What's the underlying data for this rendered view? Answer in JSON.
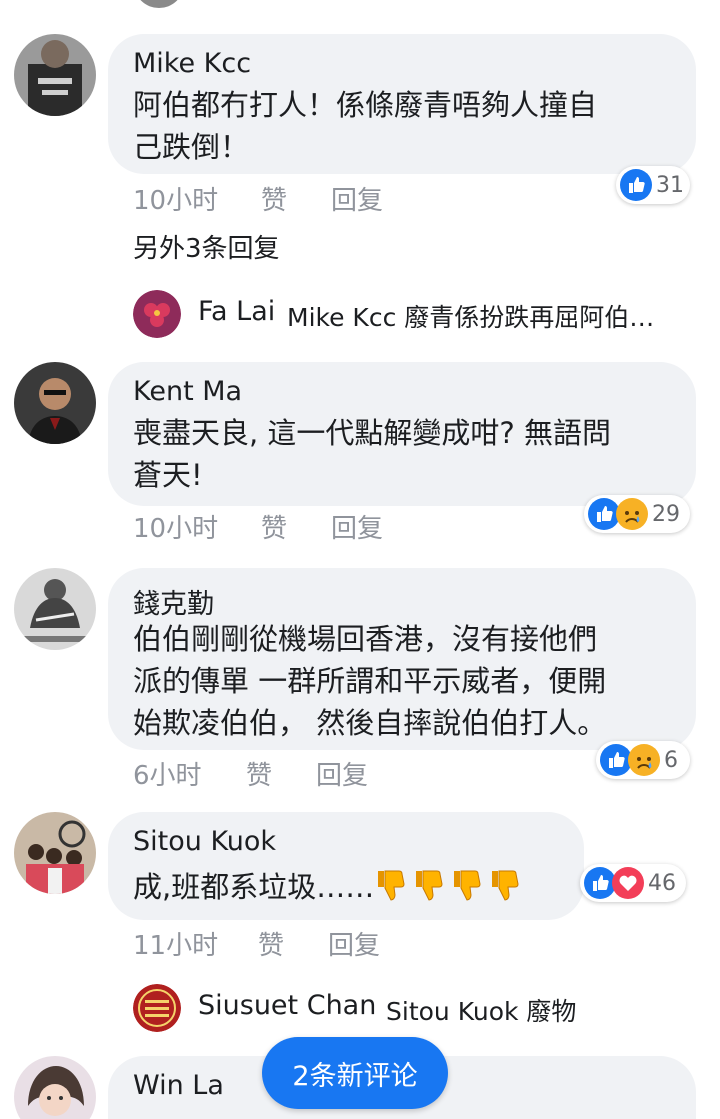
{
  "comments": [
    {
      "author": "Mike Kcc",
      "lines": [
        "阿伯都冇打人！係條廢青唔夠人撞自",
        "己跌倒！"
      ],
      "time": "10小时",
      "like_label": "赞",
      "reply_label": "回复",
      "reaction_count": "31",
      "reactions": [
        "like"
      ]
    },
    {
      "author": "Kent Ma",
      "lines": [
        "喪盡天良, 這一代點解變成咁? 無語問",
        "蒼天!"
      ],
      "time": "10小时",
      "like_label": "赞",
      "reply_label": "回复",
      "reaction_count": "29",
      "reactions": [
        "like",
        "sad"
      ]
    },
    {
      "author": "錢克勤",
      "lines": [
        "伯伯剛剛從機場回香港，沒有接他們",
        "派的傳單 一群所謂和平示威者，便開",
        "始欺凌伯伯， 然後自摔說伯伯打人。"
      ],
      "time": "6小时",
      "like_label": "赞",
      "reply_label": "回复",
      "reaction_count": "6",
      "reactions": [
        "like",
        "sad"
      ]
    },
    {
      "author": "Sitou Kuok",
      "text": "成,班都系垃圾……",
      "time": "11小时",
      "like_label": "赞",
      "reply_label": "回复",
      "reaction_count": "46",
      "reactions": [
        "like",
        "love"
      ]
    },
    {
      "author": "Win La"
    }
  ],
  "more_replies_label": "另外3条回复",
  "replies": [
    {
      "author": "Fa Lai",
      "snippet": "Mike Kcc 廢青係扮跌再屈阿伯…"
    },
    {
      "author": "Siusuet Chan",
      "snippet": "Sitou Kuok 廢物"
    }
  ],
  "new_comments_label": "2条新评论",
  "colors": {
    "accent": "#1877f2",
    "bubble": "#f0f2f5",
    "meta": "#90949c",
    "love": "#f33e58",
    "sad": "#f7b125"
  }
}
